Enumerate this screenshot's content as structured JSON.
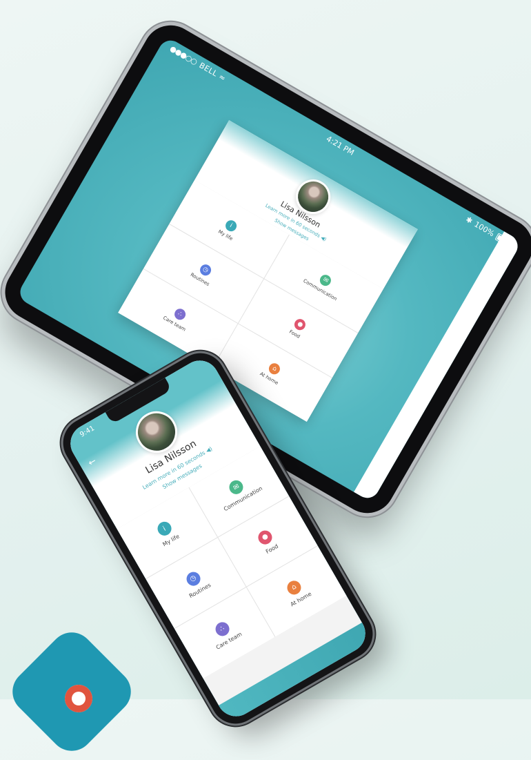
{
  "colors": {
    "background": "#e6f2ef",
    "teal": "#47aebb",
    "logo": "#1f98b2",
    "communication": "#4bb88a",
    "my_life": "#3aa9b7",
    "food": "#e0556e",
    "routines": "#5b7ee0",
    "at_home": "#e9803f",
    "care_team": "#7d6fcf"
  },
  "tablet": {
    "status": {
      "carrier": "BELL",
      "signal_dots": "●●●○○",
      "time": "4:21 PM",
      "battery": "100%"
    }
  },
  "phone": {
    "status": {
      "time": "9:41"
    }
  },
  "profile": {
    "name": "Lisa Nilsson",
    "learn_more": "Learn more in 60 seconds",
    "show_messages": "Show messages",
    "back_icon": "arrow-left-icon"
  },
  "tiles": [
    {
      "label": "My life",
      "icon": "person-icon",
      "glyph": "i",
      "color": "#3aa9b7"
    },
    {
      "label": "Communication",
      "icon": "chat-icon",
      "glyph": "✉",
      "color": "#4bb88a"
    },
    {
      "label": "Routines",
      "icon": "clock-icon",
      "glyph": "◷",
      "color": "#5b7ee0"
    },
    {
      "label": "Food",
      "icon": "apple-icon",
      "glyph": "●",
      "color": "#e0556e"
    },
    {
      "label": "Care team",
      "icon": "team-icon",
      "glyph": "∴",
      "color": "#7d6fcf"
    },
    {
      "label": "At home",
      "icon": "home-icon",
      "glyph": "⌂",
      "color": "#e9803f"
    }
  ]
}
